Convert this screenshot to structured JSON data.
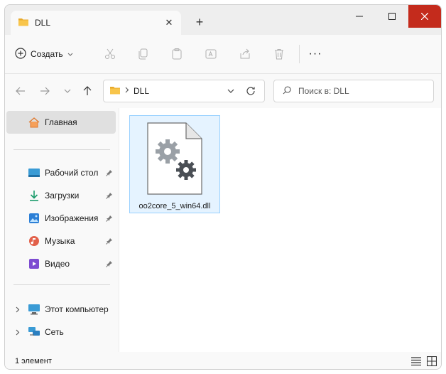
{
  "tab": {
    "title": "DLL",
    "close": "✕",
    "new": "+"
  },
  "window_controls": {
    "minimize": "—",
    "maximize": "☐",
    "close": "✕"
  },
  "toolbar": {
    "create_label": "Создать",
    "icons": [
      "cut-icon",
      "copy-icon",
      "paste-icon",
      "rename-icon",
      "share-icon",
      "delete-icon"
    ],
    "more": "···"
  },
  "address": {
    "crumb": "DLL"
  },
  "search": {
    "placeholder": "Поиск в: DLL",
    "value": ""
  },
  "sidebar": {
    "home": "Главная",
    "quick": [
      {
        "label": "Рабочий стол"
      },
      {
        "label": "Загрузки"
      },
      {
        "label": "Изображения"
      },
      {
        "label": "Музыка"
      },
      {
        "label": "Видео"
      }
    ],
    "this_pc": "Этот компьютер",
    "network": "Сеть"
  },
  "files": [
    {
      "name": "oo2core_5_win64.dll",
      "selected": true
    }
  ],
  "status": {
    "count": "1 элемент"
  },
  "colors": {
    "accent_selection": "#e5f3ff",
    "selection_border": "#99d1ff",
    "folder": "#f8c54b",
    "close_red": "#c42b1c"
  }
}
